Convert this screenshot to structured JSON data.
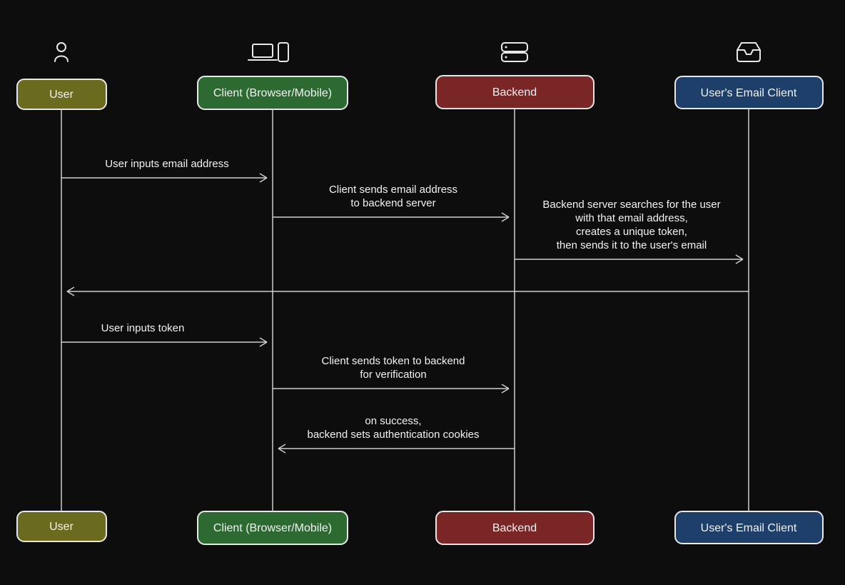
{
  "actors": {
    "user": {
      "label": "User",
      "color": "#6b6b1f"
    },
    "client": {
      "label": "Client (Browser/Mobile)",
      "color": "#2d6a32"
    },
    "backend": {
      "label": "Backend",
      "color": "#7a2626"
    },
    "email": {
      "label": "User's Email Client",
      "color": "#1f3f6b"
    }
  },
  "messages": {
    "m1": "User inputs email address",
    "m2a": "Client sends email address",
    "m2b": "to backend server",
    "m3a": "Backend server searches for the user",
    "m3b": "with that email address,",
    "m3c": "creates a unique token,",
    "m3d": "then sends it to the user's email",
    "m4": "User inputs token",
    "m5a": "Client sends token to backend",
    "m5b": "for verification",
    "m6a": "on success,",
    "m6b": "backend sets authentication cookies"
  }
}
